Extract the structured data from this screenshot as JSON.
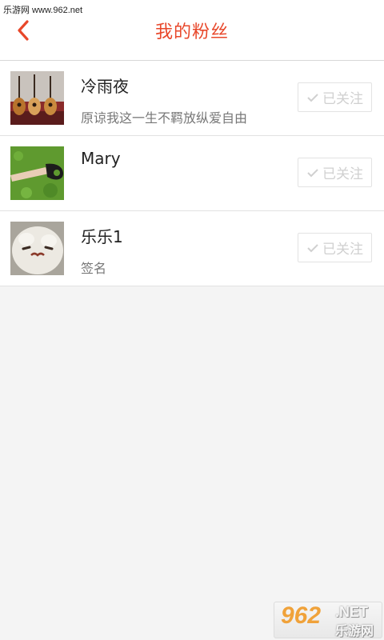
{
  "watermark": {
    "top_text": "乐游网 www.962.net"
  },
  "header": {
    "title": "我的粉丝",
    "back_icon": "chevron-left-icon",
    "accent_color": "#e8472a"
  },
  "fans": [
    {
      "name": "冷雨夜",
      "signature": "原谅我这一生不羁放纵爱自由",
      "button_label": "已关注",
      "avatar": "guitars-photo"
    },
    {
      "name": "Mary",
      "signature": "",
      "button_label": "已关注",
      "avatar": "hand-on-grass-photo"
    },
    {
      "name": "乐乐1",
      "signature": "签名",
      "button_label": "已关注",
      "avatar": "white-plush-photo"
    }
  ],
  "logo": {
    "number": "962",
    "net": ".NET",
    "cn": "乐游网"
  }
}
